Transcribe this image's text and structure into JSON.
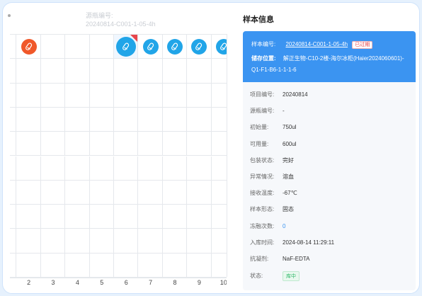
{
  "ghost": {
    "label": "源瓶编号:",
    "value": "20240814-C001-1-05-4h"
  },
  "grid": {
    "columns": [
      "2",
      "3",
      "4",
      "5",
      "6",
      "7",
      "8",
      "9",
      "10"
    ],
    "rows": 10
  },
  "panel": {
    "title": "样本信息",
    "sample_id_label": "样本编号:",
    "sample_id": "20240814-C001-1-05-4h",
    "expired_badge": "已过期",
    "location_label": "储存位置:",
    "location": "解正生物-C10-2楼-海尔冰柜(Haier2024060601)-Q1-F1-B6-1-1-1-6",
    "fields": [
      {
        "label": "项目编号:",
        "value": "20240814"
      },
      {
        "label": "源瓶编号:",
        "value": "-"
      },
      {
        "label": "初始量:",
        "value": "750ul"
      },
      {
        "label": "可用量:",
        "value": "600ul"
      },
      {
        "label": "包装状态:",
        "value": "完好"
      },
      {
        "label": "异常情况:",
        "value": "溶血"
      },
      {
        "label": "接收温度:",
        "value": "-67℃"
      },
      {
        "label": "样本形态:",
        "value": "固态"
      },
      {
        "label": "冻融次数:",
        "value": "0"
      },
      {
        "label": "入库时间:",
        "value": "2024-08-14 11:29:11"
      },
      {
        "label": "抗凝剂:",
        "value": "NaF-EDTA"
      },
      {
        "label": "状态:",
        "value": "库中"
      }
    ]
  },
  "colors": {
    "accent": "#3b94f1",
    "tube_blue": "#21a5e8",
    "tube_orange": "#f0582a",
    "alert": "#e8464b",
    "status_green": "#2fb86a"
  },
  "icons": {
    "tube": "test-tube-icon"
  }
}
